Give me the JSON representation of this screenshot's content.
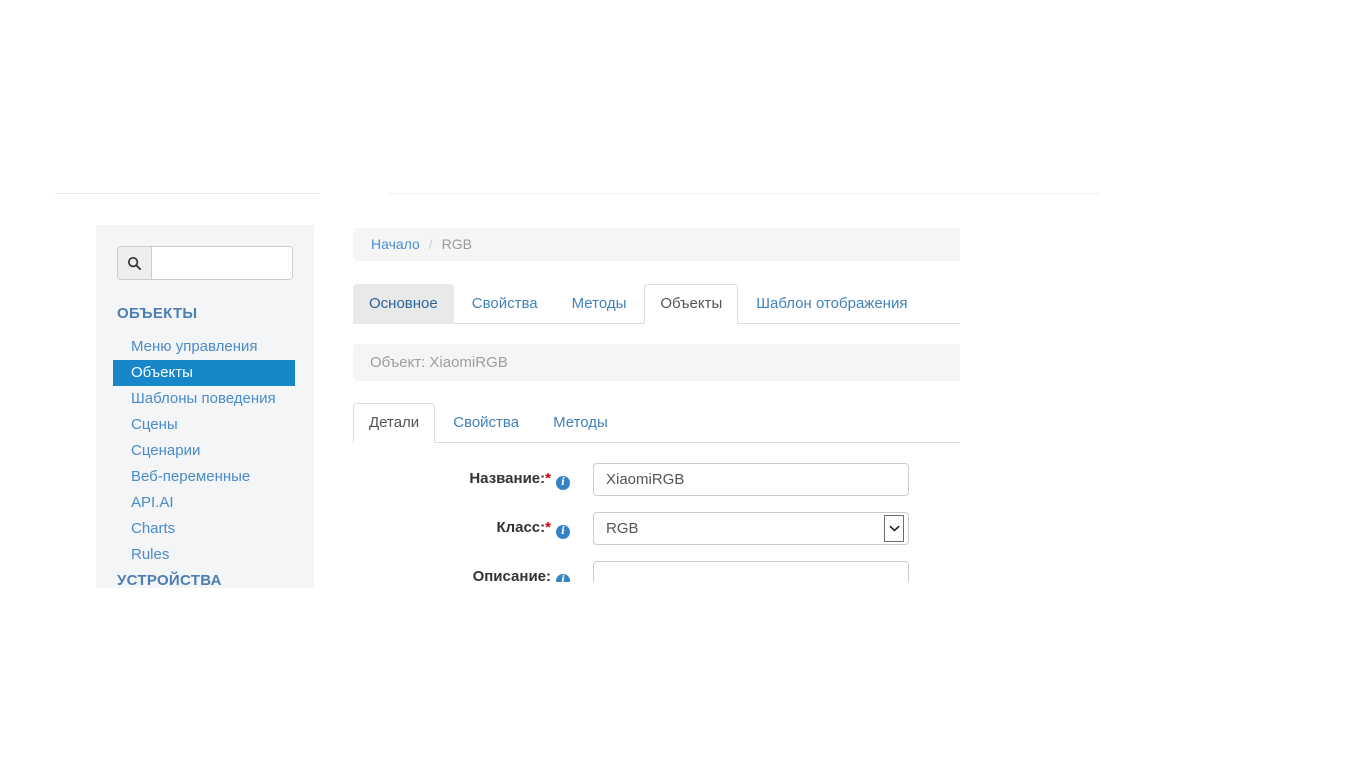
{
  "colors": {
    "accent_blue": "#1787c9",
    "sidebar_bg": "#f3f5f7",
    "sidebar_header_blue": "#4d7eb3",
    "sidebar_link_blue": "#4a8bc9",
    "tab_link_blue": "#4282ba",
    "tab_hover_gray": "#e9e9e9",
    "bar_bg": "#f5f5f5",
    "muted_text": "#9e9e9e",
    "required_red": "#cc0000",
    "info_icon_blue": "#3583c4"
  },
  "icons": {
    "search": "magnifier",
    "info": "info-circle",
    "select_arrow": "chevron-down"
  },
  "sidebar": {
    "search": {
      "placeholder": "",
      "value": ""
    },
    "section_title": "ОБЪЕКТЫ",
    "items": [
      {
        "label": "Меню управления",
        "active": false
      },
      {
        "label": "Объекты",
        "active": true
      },
      {
        "label": "Шаблоны поведения",
        "active": false
      },
      {
        "label": "Сцены",
        "active": false
      },
      {
        "label": "Сценарии",
        "active": false
      },
      {
        "label": "Веб-переменные",
        "active": false
      },
      {
        "label": "API.AI",
        "active": false
      },
      {
        "label": "Charts",
        "active": false
      },
      {
        "label": "Rules",
        "active": false
      }
    ],
    "next_section_title": "УСТРОЙСТВА"
  },
  "breadcrumb": {
    "home": "Начало",
    "separator": "/",
    "current": "RGB"
  },
  "main_tabs": [
    {
      "label": "Основное",
      "active": false
    },
    {
      "label": "Свойства",
      "active": false
    },
    {
      "label": "Методы",
      "active": false
    },
    {
      "label": "Объекты",
      "active": true
    },
    {
      "label": "Шаблон отображения",
      "active": false
    }
  ],
  "object_header": {
    "label": "Объект: XiaomiRGB"
  },
  "sub_tabs": [
    {
      "label": "Детали",
      "active": true
    },
    {
      "label": "Свойства",
      "active": false
    },
    {
      "label": "Методы",
      "active": false
    }
  ],
  "form": {
    "fields": [
      {
        "label": "Название:",
        "required_mark": "*",
        "type": "text",
        "value": "XiaomiRGB"
      },
      {
        "label": "Класс:",
        "required_mark": "*",
        "type": "select",
        "value": "RGB"
      },
      {
        "label": "Описание:",
        "required_mark": "",
        "type": "textarea",
        "value": ""
      }
    ]
  }
}
